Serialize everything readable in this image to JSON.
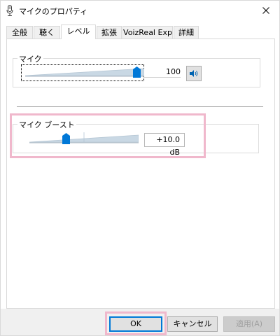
{
  "window": {
    "title": "マイクのプロパティ",
    "close_glyph": "✕"
  },
  "tabs": [
    {
      "label": "全般",
      "active": false
    },
    {
      "label": "聴く",
      "active": false
    },
    {
      "label": "レベル",
      "active": true
    },
    {
      "label": "拡張",
      "active": false
    },
    {
      "label": "VoizReal Exp",
      "active": false
    },
    {
      "label": "詳細",
      "active": false
    }
  ],
  "mic_group": {
    "label": "マイク",
    "value": "100",
    "level_percent": 100,
    "speaker_icon": "speaker-icon"
  },
  "boost_group": {
    "label": "マイク ブースト",
    "value": "+10.0 dB",
    "level_percent": 33
  },
  "colors": {
    "thumb": "#0078d7",
    "highlight": "#f0b8cc",
    "default_button_border": "#0078d7"
  },
  "buttons": {
    "ok": "OK",
    "cancel": "キャンセル",
    "apply": "適用(A)"
  }
}
